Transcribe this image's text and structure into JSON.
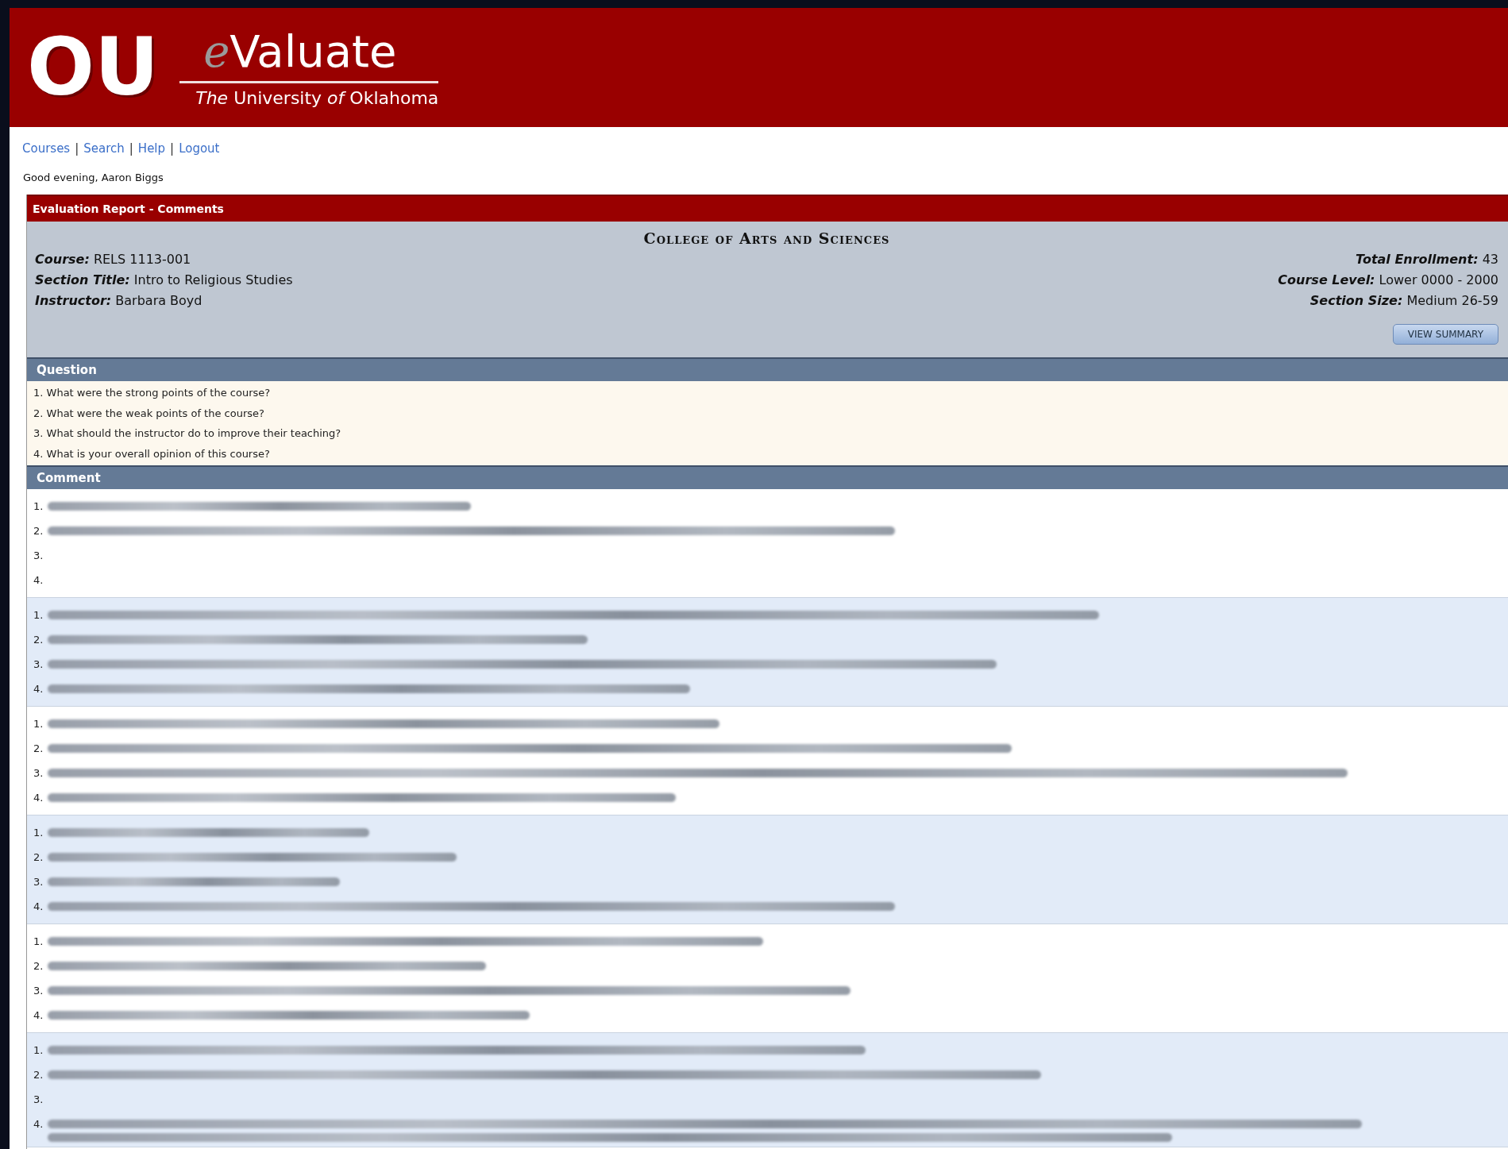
{
  "header": {
    "logo_mark": "OU",
    "app_name_prefix": "e",
    "app_name": "Valuate",
    "subtitle": "*The* University *of* Oklahoma"
  },
  "nav": [
    {
      "kind": "link",
      "label": "Courses"
    },
    {
      "kind": "separator",
      "label": "|"
    },
    {
      "kind": "link",
      "label": "Search"
    },
    {
      "kind": "separator",
      "label": "|"
    },
    {
      "kind": "link",
      "label": "Help"
    },
    {
      "kind": "separator",
      "label": "|"
    },
    {
      "kind": "link",
      "label": "Logout"
    }
  ],
  "greeting": "Good evening, Aaron Biggs",
  "report": {
    "title": "Evaluation Report - Comments",
    "college": "College of Arts and Sciences",
    "left_info": [
      {
        "label": "Course:",
        "value": "RELS 1113-001"
      },
      {
        "label": "Section Title:",
        "value": "Intro to Religious Studies"
      },
      {
        "label": "Instructor:",
        "value": "Barbara Boyd"
      }
    ],
    "right_info": [
      {
        "label": "Total Enrollment:",
        "value": "43"
      },
      {
        "label": "Course Level:",
        "value": "Lower 0000 - 2000"
      },
      {
        "label": "Section Size:",
        "value": "Medium 26-59"
      }
    ],
    "button": "VIEW SUMMARY",
    "question_heading": "Question",
    "questions": [
      "1. What were the strong points of the course?",
      "2. What were the weak points of the course?",
      "3. What should the instructor do to improve their teaching?",
      "4. What is your overall opinion of this course?"
    ],
    "comment_heading": "Comment",
    "comments": [
      {
        "answers": [
          {
            "number": "1.",
            "redacted": true
          },
          {
            "number": "2.",
            "redacted": true
          },
          {
            "number": "3.",
            "redacted": false
          },
          {
            "number": "4.",
            "redacted": false
          }
        ]
      },
      {
        "answers": [
          {
            "number": "1.",
            "redacted": true
          },
          {
            "number": "2.",
            "redacted": true
          },
          {
            "number": "3.",
            "redacted": true
          },
          {
            "number": "4.",
            "redacted": true
          }
        ]
      },
      {
        "answers": [
          {
            "number": "1.",
            "redacted": true
          },
          {
            "number": "2.",
            "redacted": true
          },
          {
            "number": "3.",
            "redacted": true
          },
          {
            "number": "4.",
            "redacted": true
          }
        ]
      },
      {
        "answers": [
          {
            "number": "1.",
            "redacted": true
          },
          {
            "number": "2.",
            "redacted": true
          },
          {
            "number": "3.",
            "redacted": true
          },
          {
            "number": "4.",
            "redacted": true
          }
        ]
      },
      {
        "answers": [
          {
            "number": "1.",
            "redacted": true
          },
          {
            "number": "2.",
            "redacted": true
          },
          {
            "number": "3.",
            "redacted": true
          },
          {
            "number": "4.",
            "redacted": true
          }
        ]
      },
      {
        "answers": [
          {
            "number": "1.",
            "redacted": true
          },
          {
            "number": "2.",
            "redacted": true
          },
          {
            "number": "3.",
            "redacted": false
          },
          {
            "number": "4.",
            "redacted": true
          }
        ]
      }
    ]
  }
}
